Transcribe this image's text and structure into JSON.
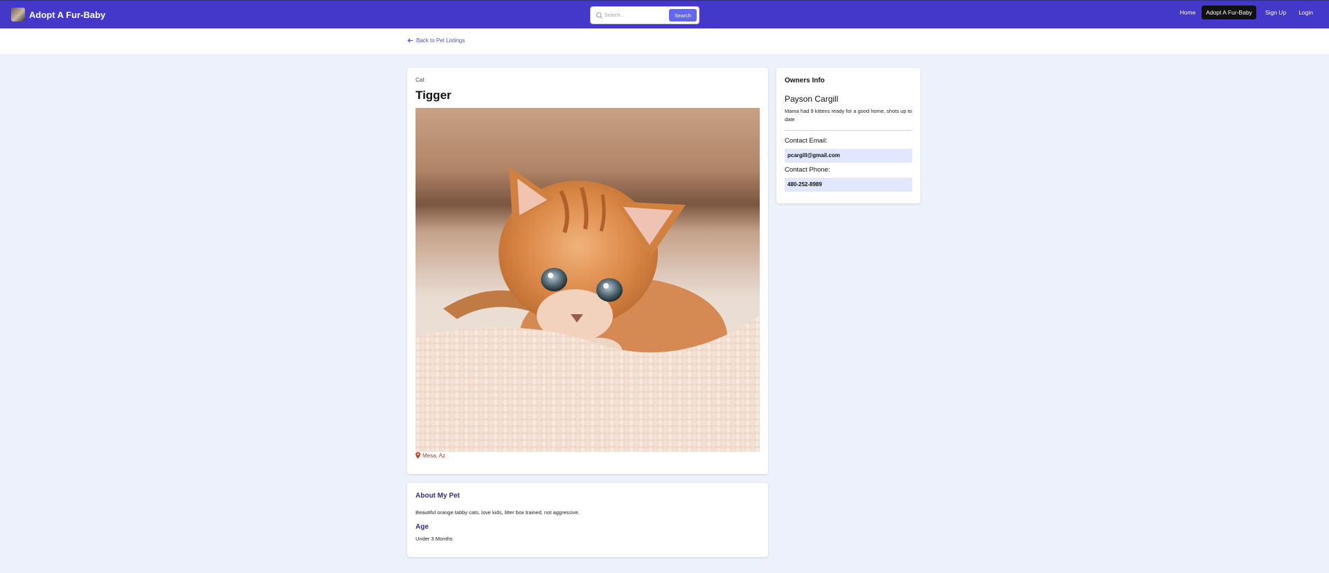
{
  "header": {
    "brand_title": "Adopt A Fur-Baby",
    "search_placeholder": "Search...",
    "search_button": "Search",
    "nav": [
      {
        "label": "Home"
      },
      {
        "label": "Adopt A Fur-Baby",
        "active": true
      },
      {
        "label": "Sign Up"
      },
      {
        "label": "Login"
      }
    ]
  },
  "back_link": "Back to Pet Listings",
  "pet": {
    "category": "Cat",
    "name": "Tigger",
    "location": "Mesa, Az"
  },
  "about": {
    "title": "About My Pet",
    "description": "Beautiful orange tabby cats, love kids, litter box trained, not aggressive.",
    "age_title": "Age",
    "age_value": "Under 3 Months"
  },
  "owner": {
    "heading": "Owners Info",
    "name": "Payson Cargill",
    "description": "Mama had 9 kittens ready for a good home, shots up to date",
    "email_label": "Contact Email:",
    "email": "pcargill@gmail.com",
    "phone_label": "Contact Phone:",
    "phone": "480-252-8989"
  },
  "colors": {
    "nav_bg": "#4338ca",
    "accent": "#6366f1",
    "page_bg": "#edf1fc",
    "heading_accent": "#312e81",
    "contact_bg": "#e0e7ff"
  }
}
